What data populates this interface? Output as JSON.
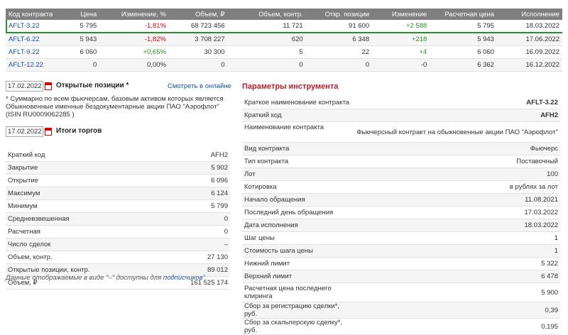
{
  "quotes": {
    "headers": [
      "Код контракта",
      "Цена",
      "Изменение, %",
      "Объем, ₽",
      "Объем, контр.",
      "Откр. позиции",
      "Изменение",
      "Расчетная цена",
      "Исполнение"
    ],
    "rows": [
      {
        "code": "AFLT-3.22",
        "price": "5 795",
        "chg_pct": "-1,81%",
        "volume_rub": "68 723 456",
        "volume_contr": "11 721",
        "open_pos": "91 600",
        "chg": "+2 588",
        "settle": "5 795",
        "expiry": "18.03.2022"
      },
      {
        "code": "AFLT-6.22",
        "price": "5 943",
        "chg_pct": "-1,82%",
        "volume_rub": "3 708 227",
        "volume_contr": "620",
        "open_pos": "6 348",
        "chg": "+218",
        "settle": "5 943",
        "expiry": "17.06.2022"
      },
      {
        "code": "AFLT-9.22",
        "price": "6 060",
        "chg_pct": "+0,65%",
        "volume_rub": "30 300",
        "volume_contr": "5",
        "open_pos": "22",
        "chg": "+4",
        "settle": "6 060",
        "expiry": "16.09.2022"
      },
      {
        "code": "AFLT-12.22",
        "price": "0",
        "chg_pct": "0,00%",
        "volume_rub": "0",
        "volume_contr": "0",
        "open_pos": "0",
        "chg": "-0",
        "settle": "6 362",
        "expiry": "16.12.2022"
      }
    ]
  },
  "open_positions": {
    "date": "17.02.2022",
    "title": "Открытые позиции *",
    "online_link": "Смотреть в онлайне",
    "note": "* Суммарно по всем фьючерсам, базовым активом которых является Обыкновенные именные бездокументарные акции ПАО \"Аэрофлот\" (ISIN RU0009062285 )"
  },
  "trading": {
    "date": "17.02.2022",
    "title": "Итоги торгов",
    "rows": [
      {
        "label": "Краткий код",
        "value": "AFH2"
      },
      {
        "label": "Закрытие",
        "value": "5 902"
      },
      {
        "label": "Открытие",
        "value": "6 096"
      },
      {
        "label": "Максимум",
        "value": "6 124"
      },
      {
        "label": "Минимум",
        "value": "5 799"
      },
      {
        "label": "Средневзвешенная",
        "value": "0"
      },
      {
        "label": "Расчетная",
        "value": "0"
      },
      {
        "label": "Число сделок",
        "value": "–"
      },
      {
        "label": "Объем, контр.",
        "value": "27 130"
      },
      {
        "label": "Открытые позиции, контр.",
        "value": "89 012"
      },
      {
        "label": "Объем, ₽",
        "value": "161 525 174"
      }
    ],
    "footnote_prefix": "Данные отображаемые в виде \"–\" доступны для ",
    "footnote_link": "подписчиков"
  },
  "params": {
    "title": "Параметры инструмента",
    "rows": [
      {
        "label": "Краткое наименование контракта",
        "value": "AFLT-3.22",
        "bold": true
      },
      {
        "label": "Краткий код",
        "value": "AFH2",
        "bold": true
      },
      {
        "label": "Наименование контракта",
        "value": "Фьючерсный контракт на обыкновенные акции ПАО \"Аэрофлот\"",
        "tall": true
      },
      {
        "label": "Вид контракта",
        "value": "Фьючерс"
      },
      {
        "label": "Тип контракта",
        "value": "Поставочный"
      },
      {
        "label": "Лот",
        "value": "100"
      },
      {
        "label": "Котировка",
        "value": "в рублях за лот"
      },
      {
        "label": "Начало обращения",
        "value": "11.08.2021"
      },
      {
        "label": "Последний день обращения",
        "value": "17.03.2022"
      },
      {
        "label": "Дата исполнения",
        "value": "18.03.2022"
      },
      {
        "label": "Шаг цены",
        "value": "1"
      },
      {
        "label": "Стоимость шага цены",
        "value": "1"
      },
      {
        "label": "Нижний лимит",
        "value": "5 322"
      },
      {
        "label": "Верхний лимит",
        "value": "6 478"
      },
      {
        "label": "Расчетная цена последнего клиринга",
        "value": "5 900",
        "tall": true
      },
      {
        "label": "Сбор за регистрацию сделки*, руб.",
        "value": "0,39"
      },
      {
        "label": "Сбор за скальперскую сделку*, руб.",
        "value": "0,195"
      }
    ]
  }
}
